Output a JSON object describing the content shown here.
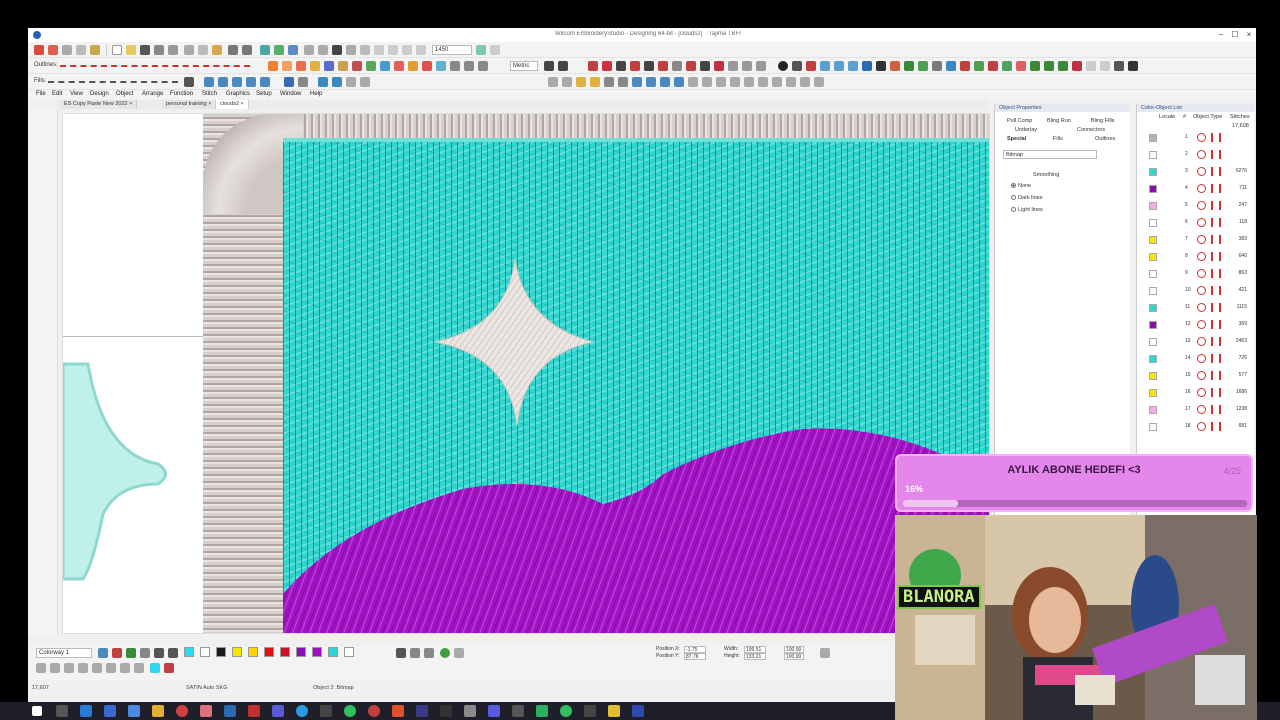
{
  "window": {
    "title": "Wilcom EmbroideryStudio - Designing 64-bit - [clouds2]",
    "title_right": "Tajima TBFI",
    "minimize": "–",
    "maximize": "☐",
    "close": "×"
  },
  "toolbars": {
    "outlines_label": "Outlines:",
    "fills_label": "Fills:",
    "zoom_value": "1450",
    "units_value": "Metric"
  },
  "menu": [
    "File",
    "Edit",
    "View",
    "Design",
    "Object",
    "Arrange",
    "Function",
    "Stitch",
    "Graphics",
    "Setup",
    "Window",
    "Help"
  ],
  "doc_tabs": [
    {
      "label": "ES Copy Paste New 2022",
      "active": false
    },
    {
      "label": "personal training",
      "active": false
    },
    {
      "label": "clouds2",
      "active": true
    }
  ],
  "object_properties": {
    "title": "Object Properties",
    "tabs_row1": [
      "Pull Comp",
      "Bling Run",
      "Bling Fills"
    ],
    "tabs_row2": [
      "Underlay",
      "Connectors"
    ],
    "tabs_row3": [
      "Special",
      "Fills",
      "Outlines"
    ],
    "dropdown_value": "Bitmap",
    "smoothing_label": "Smoothing",
    "options": [
      {
        "label": "None",
        "selected": true
      },
      {
        "label": "Dark lines",
        "selected": false
      },
      {
        "label": "Light lines",
        "selected": false
      }
    ]
  },
  "color_object_list": {
    "title": "Color-Object List",
    "headers": [
      "Locale",
      "#",
      "Object Type",
      "Stitches"
    ],
    "total": "17,608",
    "rows": [
      {
        "num": "1",
        "color": "#b8b0ac",
        "stitches": ""
      },
      {
        "num": "2",
        "color": "#ffffff",
        "stitches": ""
      },
      {
        "num": "3",
        "color": "#2fd6d0",
        "stitches": "6276"
      },
      {
        "num": "4",
        "color": "#8a0fb0",
        "stitches": "711"
      },
      {
        "num": "5",
        "color": "#f5a9e8",
        "stitches": "247"
      },
      {
        "num": "6",
        "color": "#ffffff",
        "stitches": "118"
      },
      {
        "num": "7",
        "color": "#f4e800",
        "stitches": "383"
      },
      {
        "num": "8",
        "color": "#f4e800",
        "stitches": "640"
      },
      {
        "num": "9",
        "color": "#ffffff",
        "stitches": "863"
      },
      {
        "num": "10",
        "color": "#ffffff",
        "stitches": "421"
      },
      {
        "num": "11",
        "color": "#2fd6d0",
        "stitches": "1115"
      },
      {
        "num": "12",
        "color": "#8a0fb0",
        "stitches": "369"
      },
      {
        "num": "13",
        "color": "#ffffff",
        "stitches": "2463"
      },
      {
        "num": "14",
        "color": "#2fd6d0",
        "stitches": "726"
      },
      {
        "num": "15",
        "color": "#f4e800",
        "stitches": "577"
      },
      {
        "num": "16",
        "color": "#f4e800",
        "stitches": "1686"
      },
      {
        "num": "17",
        "color": "#f5a9e8",
        "stitches": "1238"
      },
      {
        "num": "18",
        "color": "#ffffff",
        "stitches": "681"
      }
    ]
  },
  "bottom": {
    "colorway_label": "Colorway 1",
    "position_x_label": "Position X:",
    "position_y_label": "Position Y:",
    "position_x": "-1.75",
    "position_y": "87.76",
    "width_label": "Width:",
    "height_label": "Height:",
    "width": "199.51",
    "height": "133.21",
    "scale_w": "100.00",
    "scale_h": "100.00",
    "swatches": [
      "#2ed6f0",
      "#ffffff",
      "#1a1a1a",
      "#f4e800",
      "#ffd400",
      "#e01010",
      "#d0102a",
      "#8a0fb0",
      "#a010c0",
      "#2fd6d0",
      "#ffffff"
    ]
  },
  "status": {
    "left": "17,607",
    "middle": "SATIN Auto SKG",
    "object": "Object 2: Bitmap"
  },
  "stream": {
    "goal_title": "AYLIK ABONE HEDEFI <3",
    "goal_count": "4/25",
    "goal_percent_text": "16%",
    "goal_percent": 16,
    "cam_sign": "BLANORA"
  },
  "colors": {
    "cyan_fill": "#2ed6cf",
    "purple_fill": "#a010c0",
    "satin_border": "#d8d0cc",
    "overlay_pink": "#e487ea"
  }
}
